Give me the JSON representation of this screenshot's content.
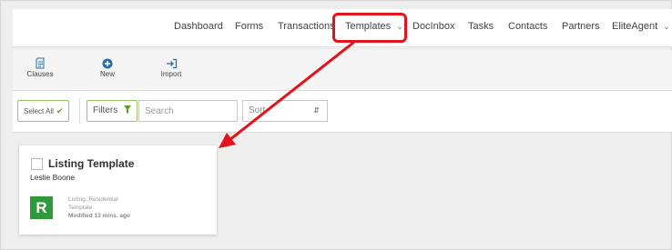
{
  "nav": {
    "items": [
      {
        "label": "Dashboard"
      },
      {
        "label": "Forms"
      },
      {
        "label": "Transactions"
      },
      {
        "label": "Templates",
        "dropdown": true
      },
      {
        "label": "DocInbox"
      },
      {
        "label": "Tasks"
      },
      {
        "label": "Contacts"
      },
      {
        "label": "Partners"
      },
      {
        "label": "EliteAgent",
        "dropdown": true
      }
    ],
    "highlighted_item": "Templates",
    "highlight_color": "#e3121b"
  },
  "toolbar": {
    "clauses_label": "Clauses",
    "new_label": "New",
    "import_label": "Import",
    "icons": [
      "document-icon",
      "plus-circle-icon",
      "import-icon"
    ]
  },
  "filters": {
    "select_all_label": "Select All",
    "filters_label": "Filters",
    "search_placeholder": "Search",
    "sort_label": "Sort"
  },
  "card": {
    "title": "Listing Template",
    "owner": "Leslie Boone",
    "logo_letter": "R",
    "logo_color": "#2e9a3c",
    "category": "Listing, Residential",
    "type": "Template",
    "modified": "Modified 13 mins. ago"
  },
  "colors": {
    "accent_green": "#9bc36a",
    "icon_blue": "#2e6da4",
    "annotation_red": "#e3121b"
  }
}
